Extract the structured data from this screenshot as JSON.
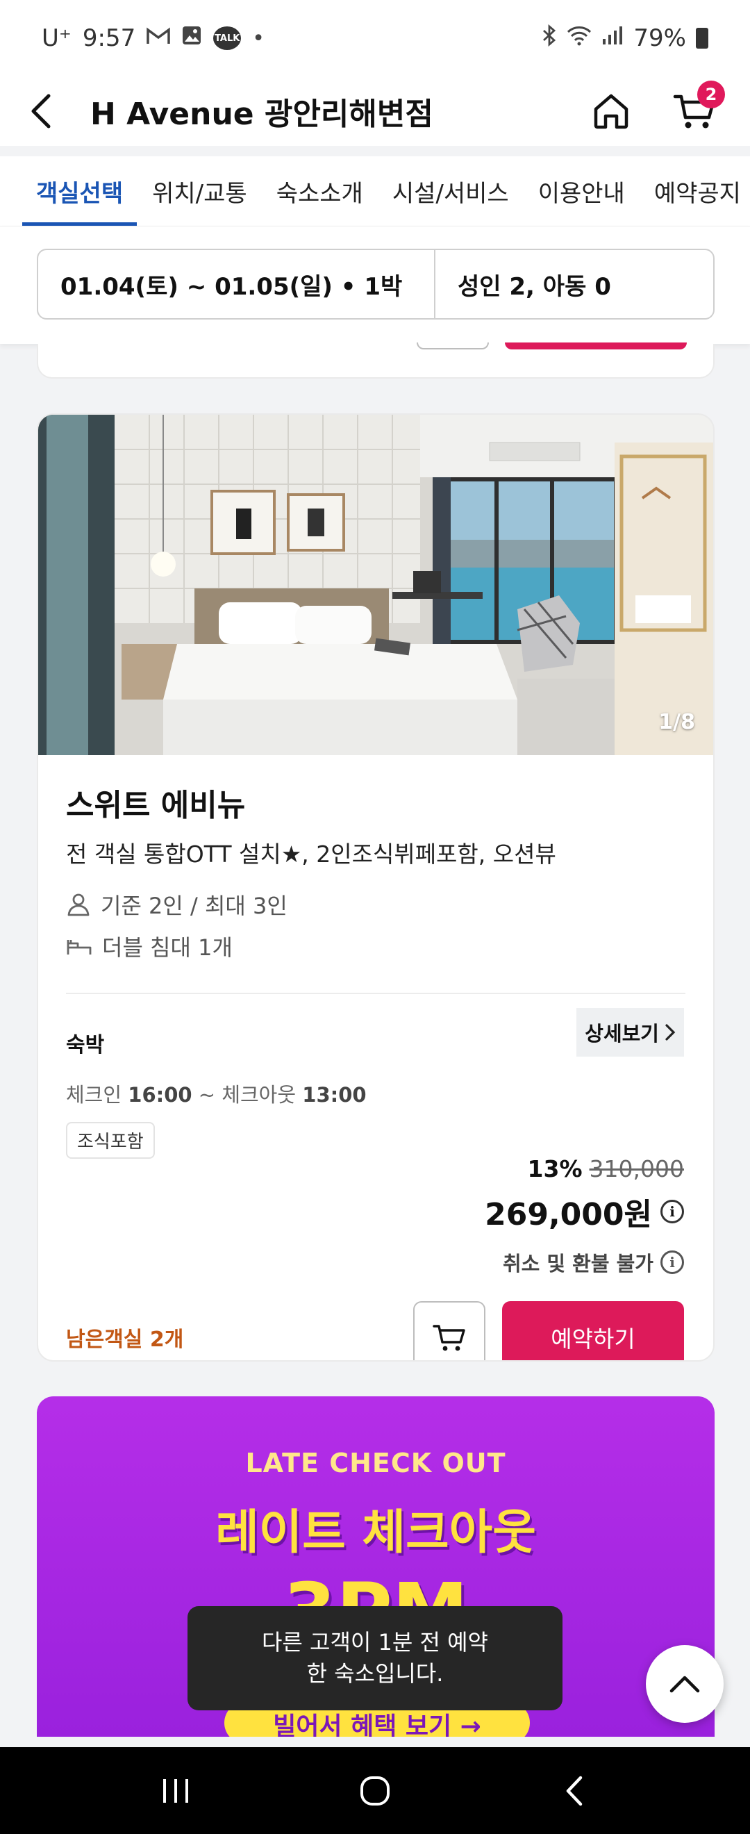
{
  "status_bar": {
    "carrier": "U⁺",
    "time": "9:57",
    "talk_label": "TALK",
    "battery": "79%"
  },
  "header": {
    "title": "H Avenue 광안리해변점",
    "cart_count": "2"
  },
  "tabs": [
    {
      "label": "객실선택",
      "active": true
    },
    {
      "label": "위치/교통"
    },
    {
      "label": "숙소소개"
    },
    {
      "label": "시설/서비스"
    },
    {
      "label": "이용안내"
    },
    {
      "label": "예약공지"
    }
  ],
  "search": {
    "dates": "01.04(토) ~ 01.05(일) • 1박",
    "guests": "성인 2, 아동 0"
  },
  "room": {
    "photo_counter": "1/8",
    "name": "스위트 에비뉴",
    "description": "전 객실 통합OTT 설치★, 2인조식뷔페포함, 오션뷰",
    "capacity": "기준 2인 / 최대 3인",
    "bed": "더블 침대 1개",
    "rate": {
      "type": "숙박",
      "detail_label": "상세보기",
      "checkin_label": "체크인",
      "checkin_time": "16:00",
      "checkout_label": "~ 체크아웃",
      "checkout_time": "13:00",
      "tag": "조식포함",
      "discount": "13%",
      "original_price": "310,000",
      "final_price": "269,000원",
      "refund_policy": "취소 및 환불 불가",
      "remaining": "남은객실 2개",
      "book_label": "예약하기"
    }
  },
  "banner": {
    "english": "LATE CHECK OUT",
    "korean": "레이트 체크아웃",
    "time": "3PM",
    "cta": "빌어서 혜택 보기 →"
  },
  "toast": {
    "line1": "다른 고객이 1분 전 예약",
    "line2": "한 숙소입니다."
  },
  "colors": {
    "accent_blue": "#1a55b4",
    "book_pink": "#dd1a5a",
    "remaining_orange": "#c25714",
    "banner_purple": "#a327e2",
    "banner_yellow": "#ffe23f"
  }
}
